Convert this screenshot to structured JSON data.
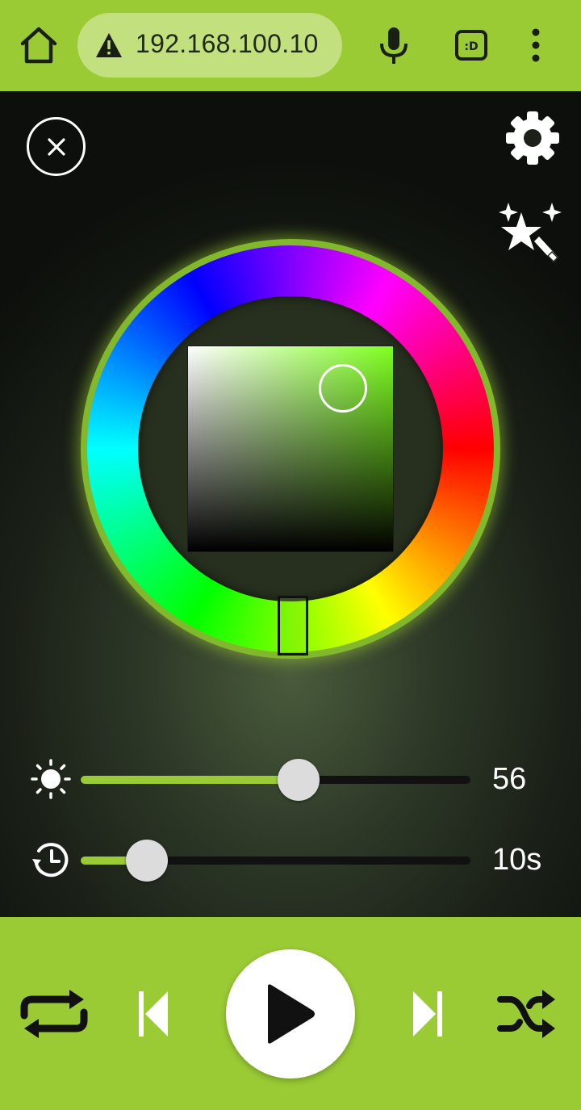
{
  "browser": {
    "url": "192.168.100.10",
    "icons": [
      "home-icon",
      "warning-icon",
      "mic-icon",
      "tab-switcher-icon",
      "more-vert-icon"
    ]
  },
  "main": {
    "icons": [
      "close-icon",
      "gear-icon",
      "magic-wand-icon"
    ],
    "colors": {
      "accent": "#9acb34",
      "selected_color": "#80ff20"
    }
  },
  "sliders": {
    "brightness": {
      "value": "56",
      "level_percent": 56,
      "icon": "brightness-icon"
    },
    "timer": {
      "value": "10s",
      "level_percent": 17,
      "icon": "history-timer-icon"
    }
  },
  "controls": {
    "icons": [
      "repeat-icon",
      "skip-previous-icon",
      "play-icon",
      "skip-next-icon",
      "shuffle-icon"
    ]
  }
}
